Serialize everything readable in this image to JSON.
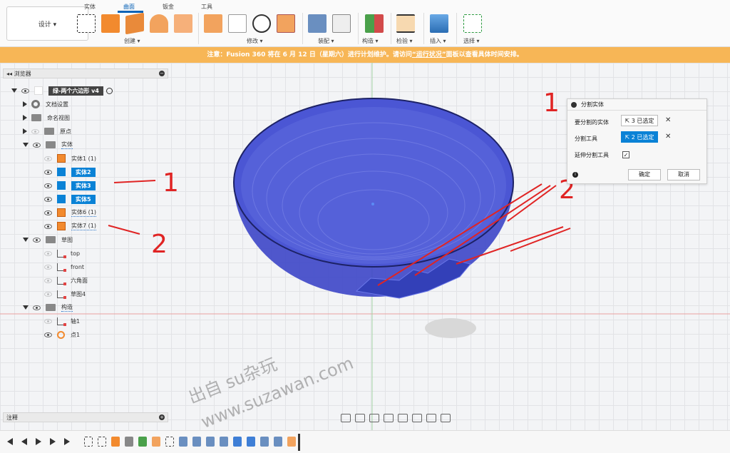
{
  "toolbar": {
    "workspace": "设计 ▾",
    "tabs": [
      "实体",
      "曲面",
      "钣金",
      "工具"
    ],
    "active_tab": "曲面",
    "groups": [
      "创建 ▾",
      "修改 ▾",
      "装配 ▾",
      "构造 ▾",
      "检验 ▾",
      "插入 ▾",
      "选择 ▾"
    ]
  },
  "notice": {
    "prefix": "注意：Fusion 360 将在 6 月 12 日（星期六）进行计划维护。请访问",
    "link": "“运行状况”",
    "suffix": "面板以查看具体时间安排。"
  },
  "browser": {
    "title": "浏览器",
    "root": "绿-两个六边形 v4",
    "items": {
      "doc_settings": "文档设置",
      "named_views": "命名视图",
      "origin": "原点",
      "bodies": "实体",
      "body1": "实体1 (1)",
      "body2": "实体2",
      "body3": "实体3",
      "body5": "实体5",
      "body6": "实体6 (1)",
      "body7": "实体7 (1)",
      "sketches": "草图",
      "sk_top": "top",
      "sk_front": "front",
      "sk_hex": "六角面",
      "sk4": "草图4",
      "construction": "构造",
      "axis1": "轴1",
      "point1": "点1"
    }
  },
  "dialog": {
    "title": "分割实体",
    "label_bodies": "要分割的实体",
    "label_tool": "分割工具",
    "label_extend": "延伸分割工具",
    "bodies_value": "3 已选定",
    "tool_value": "2 已选定",
    "ok": "确定",
    "cancel": "取消",
    "extend_checked": "✓"
  },
  "bottom": {
    "comments": "注释"
  },
  "annotations": {
    "n1": "1",
    "n2": "2",
    "n1b": "1",
    "n2b": "2"
  },
  "watermark": {
    "line1": "出自 su杂玩",
    "line2": "www.suzawan.com"
  },
  "colors": {
    "accent": "#0a82d6",
    "notice": "#f7b656",
    "bowl": "#3d46c8",
    "arrow": "#e02424"
  }
}
